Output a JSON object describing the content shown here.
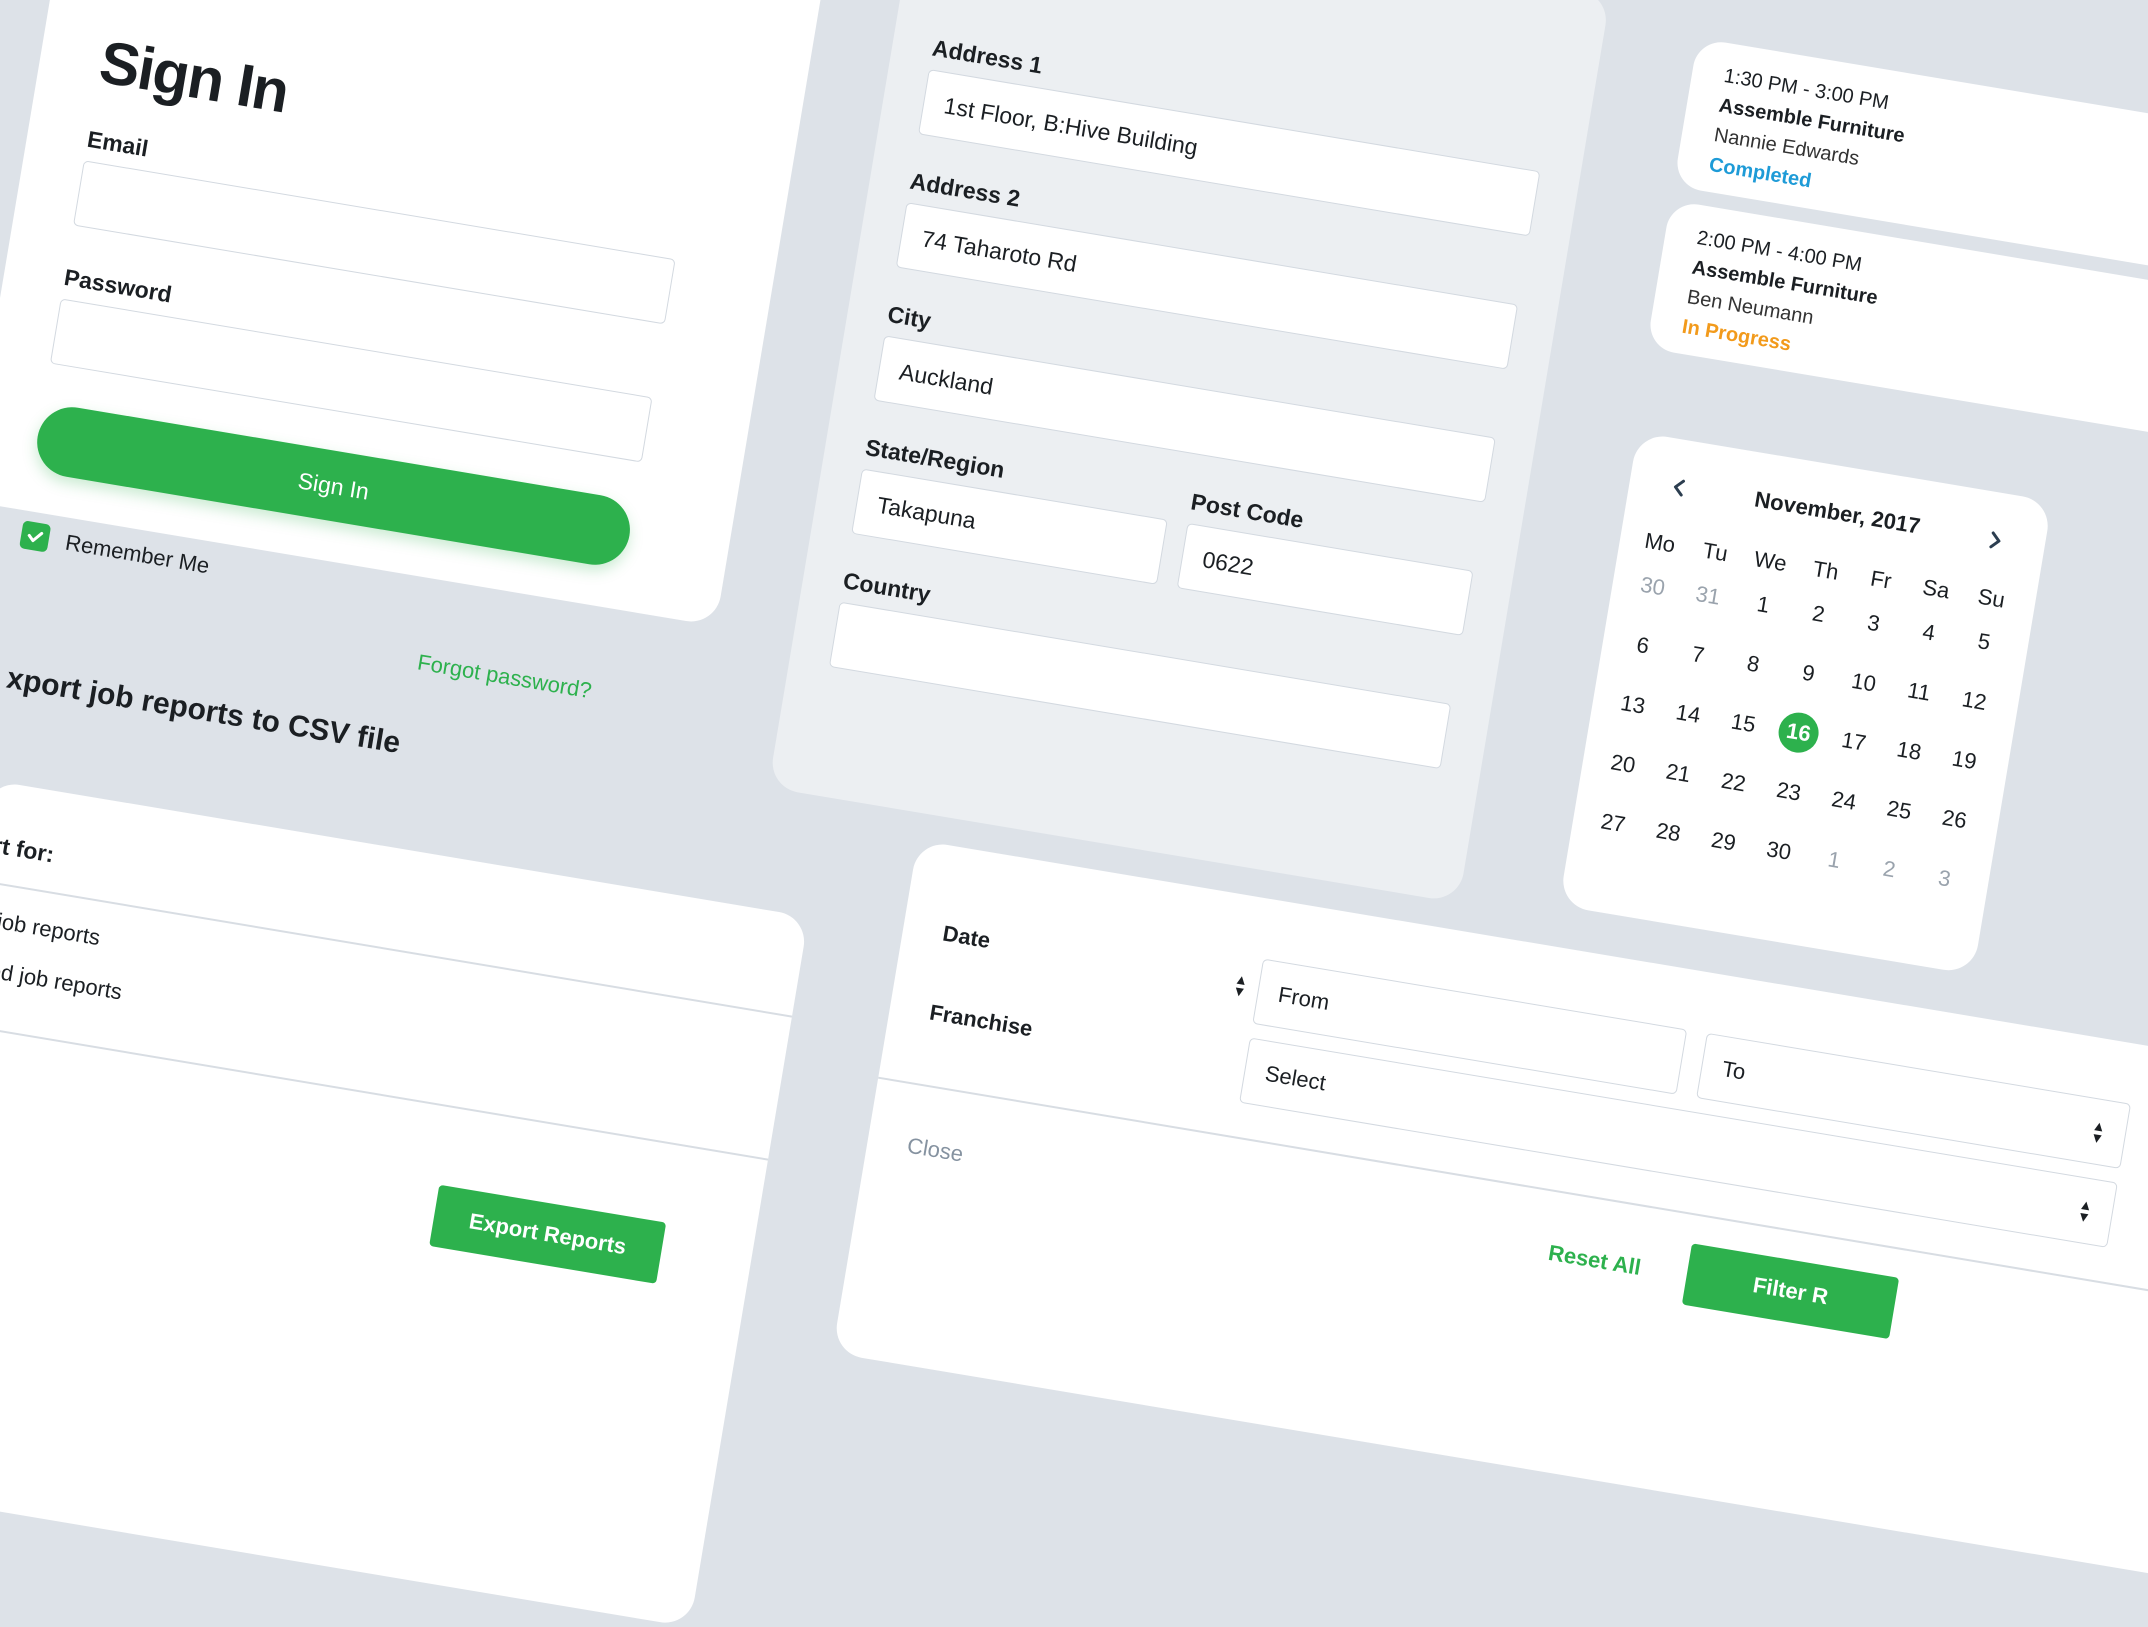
{
  "signin": {
    "title": "Sign In",
    "email_label": "Email",
    "email_value": "",
    "password_label": "Password",
    "password_value": "",
    "submit_label": "Sign In",
    "remember_label": "Remember Me",
    "remember_checked": true,
    "forgot_label": "Forgot password?"
  },
  "address": {
    "address1_label": "Address 1",
    "address1_value": "1st Floor, B:Hive Building",
    "address2_label": "Address 2",
    "address2_value": "74 Taharoto Rd",
    "city_label": "City",
    "city_value": "Auckland",
    "state_label": "State/Region",
    "state_value": "Takapuna",
    "postcode_label": "Post Code",
    "postcode_value": "0622",
    "country_label": "Country",
    "country_value": ""
  },
  "jobs": [
    {
      "time": "1:30 PM - 3:00 PM",
      "title": "Assemble Furniture",
      "person": "Nannie Edwards",
      "status": "Completed",
      "status_color": "#1E9BD7"
    },
    {
      "time": "2:00 PM - 4:00 PM",
      "title": "Assemble Furniture",
      "person": "Ben Neumann",
      "status": "In Progress",
      "status_color": "#F29A1B"
    }
  ],
  "calendar": {
    "month_label": "November, 2017",
    "weekdays": [
      "Mo",
      "Tu",
      "We",
      "Th",
      "Fr",
      "Sa",
      "Su"
    ],
    "weeks": [
      [
        "30",
        "31",
        "1",
        "2",
        "3",
        "4",
        "5"
      ],
      [
        "6",
        "7",
        "8",
        "9",
        "10",
        "11",
        "12"
      ],
      [
        "13",
        "14",
        "15",
        "16",
        "17",
        "18",
        "19"
      ],
      [
        "20",
        "21",
        "22",
        "23",
        "24",
        "25",
        "26"
      ],
      [
        "27",
        "28",
        "29",
        "30",
        "1",
        "2",
        "3"
      ]
    ],
    "selected_day": "16",
    "accent": "#2DB14D"
  },
  "export": {
    "title": "xport job reports to CSV file",
    "section_label": "ort for:",
    "option_all": "All job reports",
    "option_filtered": "ltered job reports",
    "button_label": "Export Reports"
  },
  "filter": {
    "date_label": "Date",
    "from_placeholder": "From",
    "to_placeholder": "To",
    "franchise_label": "Franchise",
    "franchise_value": "Select",
    "close_label": "Close",
    "reset_label": "Reset All",
    "filter_label": "Filter R"
  },
  "colors": {
    "background": "#DDE2E8",
    "accent_green": "#2DB14D",
    "completed_blue": "#1E9BD7",
    "in_progress_orange": "#F29A1B"
  }
}
